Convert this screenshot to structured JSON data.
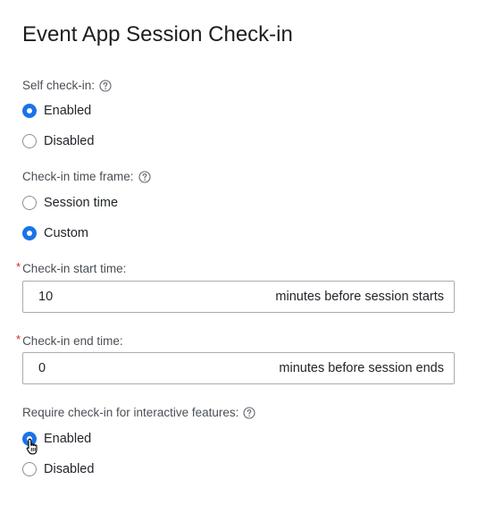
{
  "page": {
    "title": "Event App Session Check-in"
  },
  "self_checkin": {
    "label": "Self check-in:",
    "options": [
      "Enabled",
      "Disabled"
    ],
    "selected": "Enabled"
  },
  "timeframe": {
    "label": "Check-in time frame:",
    "options": [
      "Session time",
      "Custom"
    ],
    "selected": "Custom"
  },
  "start_time": {
    "required_mark": "*",
    "label": "Check-in start time:",
    "value": "10",
    "suffix": "minutes before session starts"
  },
  "end_time": {
    "required_mark": "*",
    "label": "Check-in end time:",
    "value": "0",
    "suffix": "minutes before session ends"
  },
  "interactive": {
    "label": "Require check-in for interactive features:",
    "options": [
      "Enabled",
      "Disabled"
    ],
    "selected": "Enabled"
  },
  "colors": {
    "accent": "#1a73e8",
    "required": "#d7262a",
    "label_text": "#4a4f55",
    "border": "#a7acb2"
  },
  "icons": {
    "help": "question-circle-icon",
    "pointer": "hand-pointer-cursor-icon"
  }
}
